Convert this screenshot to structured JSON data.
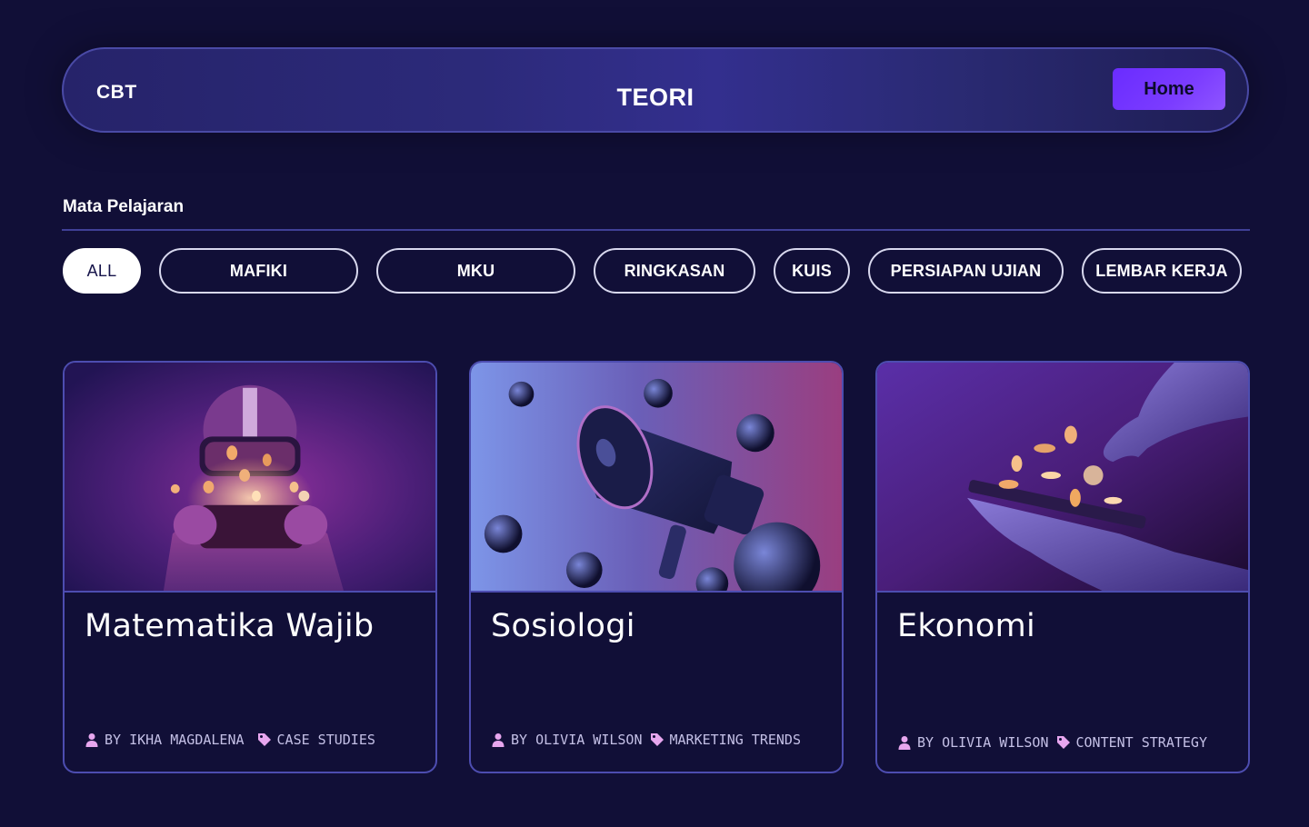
{
  "header": {
    "brand": "CBT",
    "title": "TEORI",
    "home_label": "Home"
  },
  "section": {
    "heading": "Mata Pelajaran"
  },
  "filters": [
    {
      "label": "ALL",
      "active": true
    },
    {
      "label": "MAFIKI",
      "active": false
    },
    {
      "label": "MKU",
      "active": false
    },
    {
      "label": "RINGKASAN",
      "active": false
    },
    {
      "label": "KUIS",
      "active": false
    },
    {
      "label": "PERSIAPAN UJIAN",
      "active": false
    },
    {
      "label": "LEMBAR KERJA",
      "active": false
    }
  ],
  "cards": [
    {
      "title": "Matematika Wajib",
      "author": "BY IKHA MAGDALENA",
      "tag": "CASE STUDIES",
      "image": "vr-gamer-illustration"
    },
    {
      "title": "Sosiologi",
      "author": "BY OLIVIA WILSON",
      "tag": "MARKETING TRENDS",
      "image": "megaphone-illustration"
    },
    {
      "title": "Ekonomi",
      "author": "BY OLIVIA WILSON",
      "tag": "CONTENT STRATEGY",
      "image": "hands-coins-illustration"
    }
  ],
  "icons": {
    "author": "user-icon",
    "tag": "tag-icon"
  },
  "colors": {
    "background": "#110f37",
    "accent": "#7b3cff",
    "card_border": "#4d4db0",
    "meta_icon": "#e7a6ee"
  }
}
